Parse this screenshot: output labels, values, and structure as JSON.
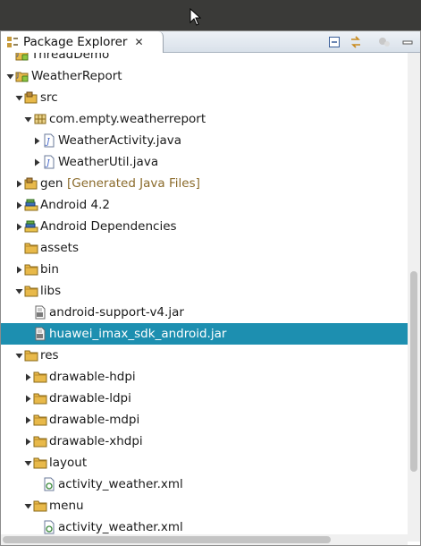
{
  "view": {
    "title": "Package Explorer",
    "close_glyph": "✕",
    "toolbar": [
      "collapse-all-icon",
      "link-with-editor-icon",
      "view-menu-icon"
    ]
  },
  "tree": {
    "rows": [
      {
        "label": "ThreadDemo",
        "depth": 0,
        "twisty": "none",
        "icon": "android-project-icon"
      },
      {
        "label": "WeatherReport",
        "depth": 0,
        "twisty": "expanded",
        "icon": "android-project-icon"
      },
      {
        "label": "src",
        "depth": 1,
        "twisty": "expanded",
        "icon": "source-folder-icon"
      },
      {
        "label": "com.empty.weatherreport",
        "depth": 2,
        "twisty": "expanded",
        "icon": "package-icon"
      },
      {
        "label": "WeatherActivity.java",
        "depth": 3,
        "twisty": "collapsed",
        "icon": "java-file-icon"
      },
      {
        "label": "WeatherUtil.java",
        "depth": 3,
        "twisty": "collapsed",
        "icon": "java-file-icon"
      },
      {
        "label": "gen",
        "depth": 1,
        "twisty": "collapsed",
        "icon": "source-folder-icon",
        "deco": "[Generated Java Files]"
      },
      {
        "label": "Android 4.2",
        "depth": 1,
        "twisty": "collapsed",
        "icon": "library-icon"
      },
      {
        "label": "Android Dependencies",
        "depth": 1,
        "twisty": "collapsed",
        "icon": "library-icon"
      },
      {
        "label": "assets",
        "depth": 1,
        "twisty": "none",
        "icon": "folder-icon"
      },
      {
        "label": "bin",
        "depth": 1,
        "twisty": "collapsed",
        "icon": "folder-icon"
      },
      {
        "label": "libs",
        "depth": 1,
        "twisty": "expanded",
        "icon": "folder-icon"
      },
      {
        "label": "android-support-v4.jar",
        "depth": 2,
        "twisty": "none",
        "icon": "jar-icon"
      },
      {
        "label": "huawei_imax_sdk_android.jar",
        "depth": 2,
        "twisty": "none",
        "icon": "jar-icon",
        "selected": true
      },
      {
        "label": "res",
        "depth": 1,
        "twisty": "expanded",
        "icon": "folder-icon"
      },
      {
        "label": "drawable-hdpi",
        "depth": 2,
        "twisty": "collapsed",
        "icon": "folder-icon"
      },
      {
        "label": "drawable-ldpi",
        "depth": 2,
        "twisty": "collapsed",
        "icon": "folder-icon"
      },
      {
        "label": "drawable-mdpi",
        "depth": 2,
        "twisty": "collapsed",
        "icon": "folder-icon"
      },
      {
        "label": "drawable-xhdpi",
        "depth": 2,
        "twisty": "collapsed",
        "icon": "folder-icon"
      },
      {
        "label": "layout",
        "depth": 2,
        "twisty": "expanded",
        "icon": "folder-icon"
      },
      {
        "label": "activity_weather.xml",
        "depth": 3,
        "twisty": "none",
        "icon": "xml-file-icon"
      },
      {
        "label": "menu",
        "depth": 2,
        "twisty": "expanded",
        "icon": "folder-icon"
      },
      {
        "label": "activity_weather.xml",
        "depth": 3,
        "twisty": "none",
        "icon": "xml-file-icon"
      }
    ]
  },
  "colors": {
    "selection": "#1d8fb0",
    "folder": "#e8b94a",
    "decoration": "#8a6a2a"
  }
}
